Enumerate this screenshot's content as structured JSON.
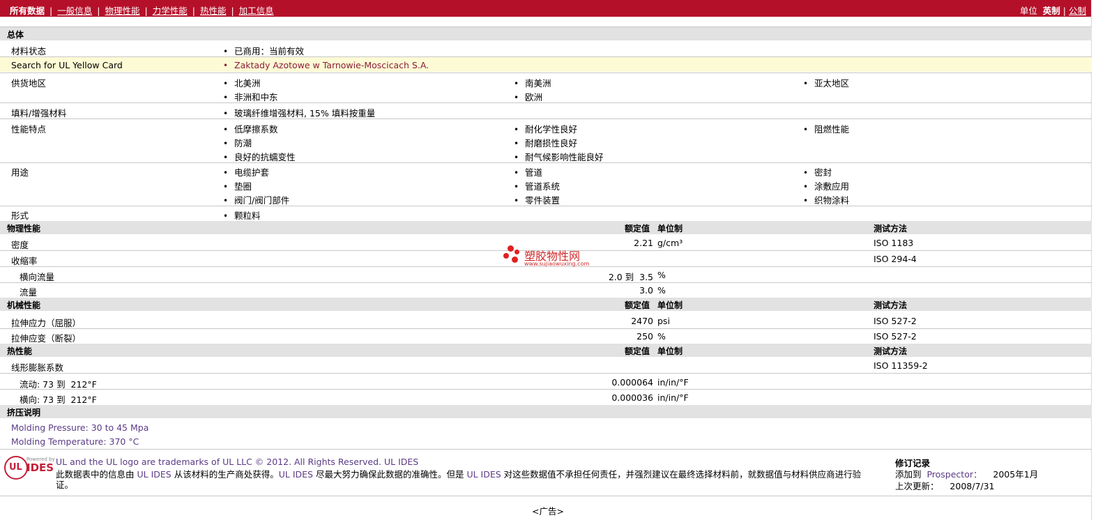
{
  "nav": {
    "all": "所有数据",
    "general": "一般信息",
    "physical": "物理性能",
    "mechanical": "力学性能",
    "thermal": "热性能",
    "processing": "加工信息",
    "units_label": "单位",
    "imperial": "英制",
    "metric": "公制"
  },
  "general": {
    "title": "总体",
    "status_label": "材料状态",
    "status_value": "已商用：当前有效",
    "yellow_label": "Search for UL Yellow Card",
    "yellow_value": "Zaktady Azotowe w Tarnowie-Moscicach S.A.",
    "supply_label": "供货地区",
    "supply": [
      "北美洲",
      "南美洲",
      "亚太地区",
      "非洲和中东",
      "欧洲"
    ],
    "filler_label": "填料/增强材料",
    "filler_value": "玻璃纤维增强材料, 15% 填料按重量",
    "features_label": "性能特点",
    "features": [
      "低摩擦系数",
      "耐化学性良好",
      "阻燃性能",
      "防潮",
      "耐磨损性良好",
      "良好的抗蠕变性",
      "耐气候影响性能良好"
    ],
    "uses_label": "用途",
    "uses": [
      "电缆护套",
      "管道",
      "密封",
      "垫圈",
      "管道系统",
      "涂敷应用",
      "阀门/阀门部件",
      "零件装置",
      "织物涂料"
    ],
    "form_label": "形式",
    "form_value": "颗粒料"
  },
  "headers": {
    "rated": "额定值",
    "unit": "单位制",
    "method": "测试方法"
  },
  "physical": {
    "title": "物理性能",
    "density_label": "密度",
    "density_value": "2.21",
    "density_unit": "g/cm³",
    "density_method": "ISO 1183",
    "shrink_label": "收缩率",
    "shrink_method": "ISO 294-4",
    "transverse_label": "横向流量",
    "transverse_value": "2.0 到  3.5",
    "transverse_unit": "%",
    "flow_label": "流量",
    "flow_value": "3.0",
    "flow_unit": "%"
  },
  "mechanical": {
    "title": "机械性能",
    "yield_label": "拉伸应力（屈服）",
    "yield_value": "2470",
    "yield_unit": "psi",
    "yield_method": "ISO 527-2",
    "break_label": "拉伸应变（断裂）",
    "break_value": "250",
    "break_unit": "%",
    "break_method": "ISO 527-2"
  },
  "thermal": {
    "title": "热性能",
    "clte_label": "线形膨胀系数",
    "clte_method": "ISO 11359-2",
    "flow_label": "流动: 73 到  212°F",
    "flow_value": "0.000064",
    "flow_unit": "in/in/°F",
    "trans_label": "横向: 73 到  212°F",
    "trans_value": "0.000036",
    "trans_unit": "in/in/°F"
  },
  "extrusion": {
    "title": "挤压说明",
    "pressure": "Molding Pressure: 30 to 45 Mpa",
    "temperature": "Molding Temperature: 370 °C"
  },
  "watermark": {
    "cn": "塑胶物性网",
    "en": "www.sujiaowuxing.com"
  },
  "footer": {
    "logo_text": "UL",
    "logo_powered": "Powered by",
    "logo_ides": "IDES",
    "trademark": "UL and the UL logo are trademarks of UL LLC © 2012. All Rights Reserved. UL IDES",
    "disc_1": "此数据表中的信息由",
    "disc_ul1": "UL IDES",
    "disc_2": "从该材料的生产商处获得。",
    "disc_ul2": "UL IDES",
    "disc_3": "尽最大努力确保此数据的准确性。但是",
    "disc_ul3": "UL IDES",
    "disc_4": "对这些数据值不承担任何责任，并强烈建议在最终选择材料前，就数据值与材料供应商进行验",
    "disc_5": "证。",
    "rev_title": "修订记录",
    "rev_added_label": "添加到",
    "rev_added_link": "Prospector：",
    "rev_added_date": "2005年1月",
    "rev_updated_label": "上次更新：",
    "rev_updated_date": "2008/7/31",
    "ad": "<广告>"
  }
}
